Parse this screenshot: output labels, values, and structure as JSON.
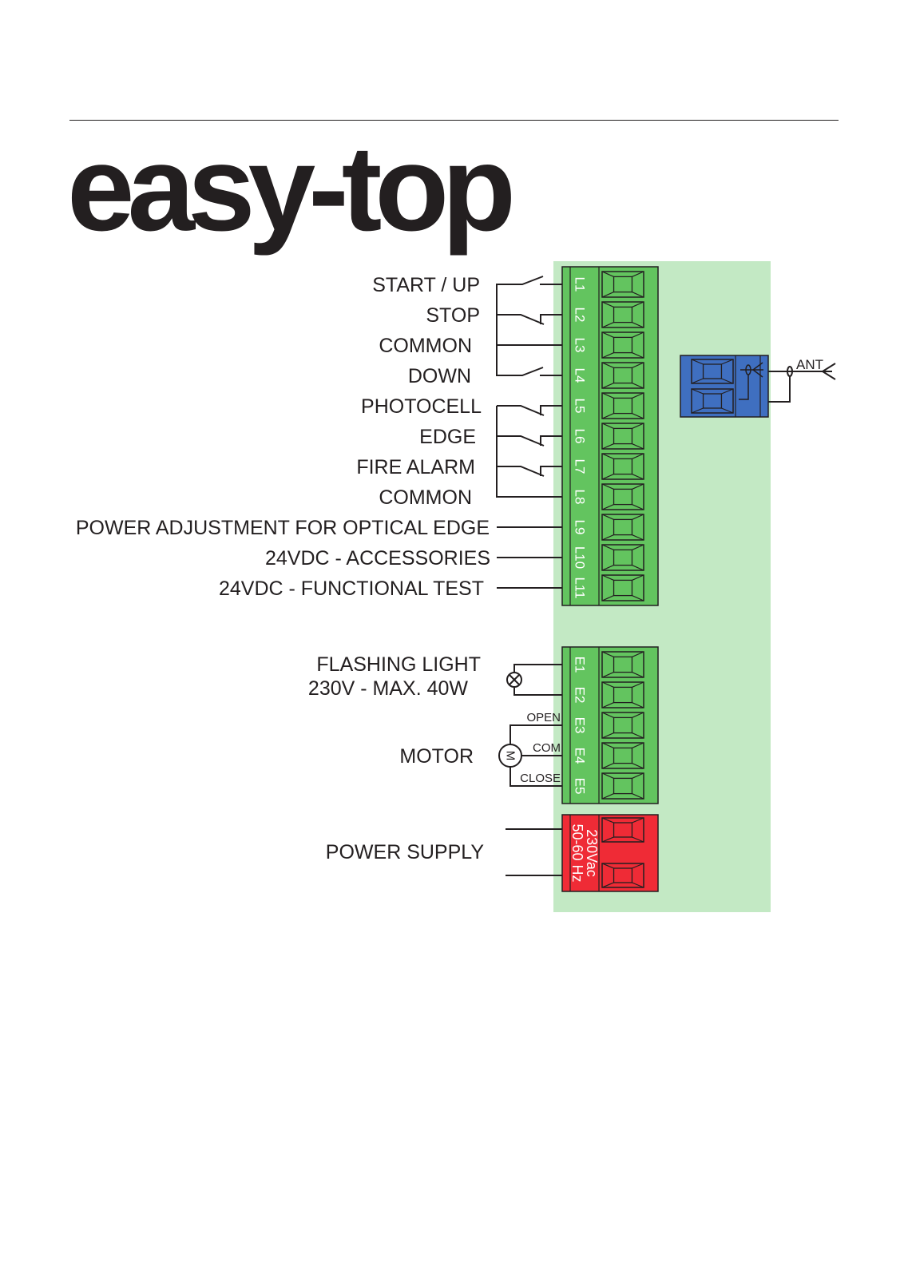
{
  "title": "easy-top",
  "colors": {
    "board": "#c3e9c4",
    "terminal_green": "#63c45f",
    "terminal_blue": "#3f6fc0",
    "terminal_red": "#ef2b36",
    "line": "#231f20"
  },
  "inputs_block": {
    "terminals": [
      "L1",
      "L2",
      "L3",
      "L4",
      "L5",
      "L6",
      "L7",
      "L8",
      "L9",
      "L10",
      "L11"
    ],
    "labels": [
      "START / UP",
      "STOP",
      "COMMON",
      "DOWN",
      "PHOTOCELL",
      "EDGE",
      "FIRE ALARM",
      "COMMON",
      "POWER ADJUSTMENT FOR OPTICAL EDGE",
      "24VDC - ACCESSORIES",
      "24VDC - FUNCTIONAL TEST"
    ]
  },
  "outputs_block": {
    "terminals": [
      "E1",
      "E2",
      "E3",
      "E4",
      "E5"
    ],
    "flashing_light": [
      "FLASHING LIGHT",
      "230V - MAX. 40W"
    ],
    "motor_label": "MOTOR",
    "motor_symbol": "M",
    "motor_wires": [
      "OPEN",
      "COM",
      "CLOSE"
    ]
  },
  "power_block": {
    "label": "POWER SUPPLY",
    "terminal_text": [
      "230Vac",
      "50-60 Hz"
    ]
  },
  "antenna": {
    "label": "ANT"
  }
}
